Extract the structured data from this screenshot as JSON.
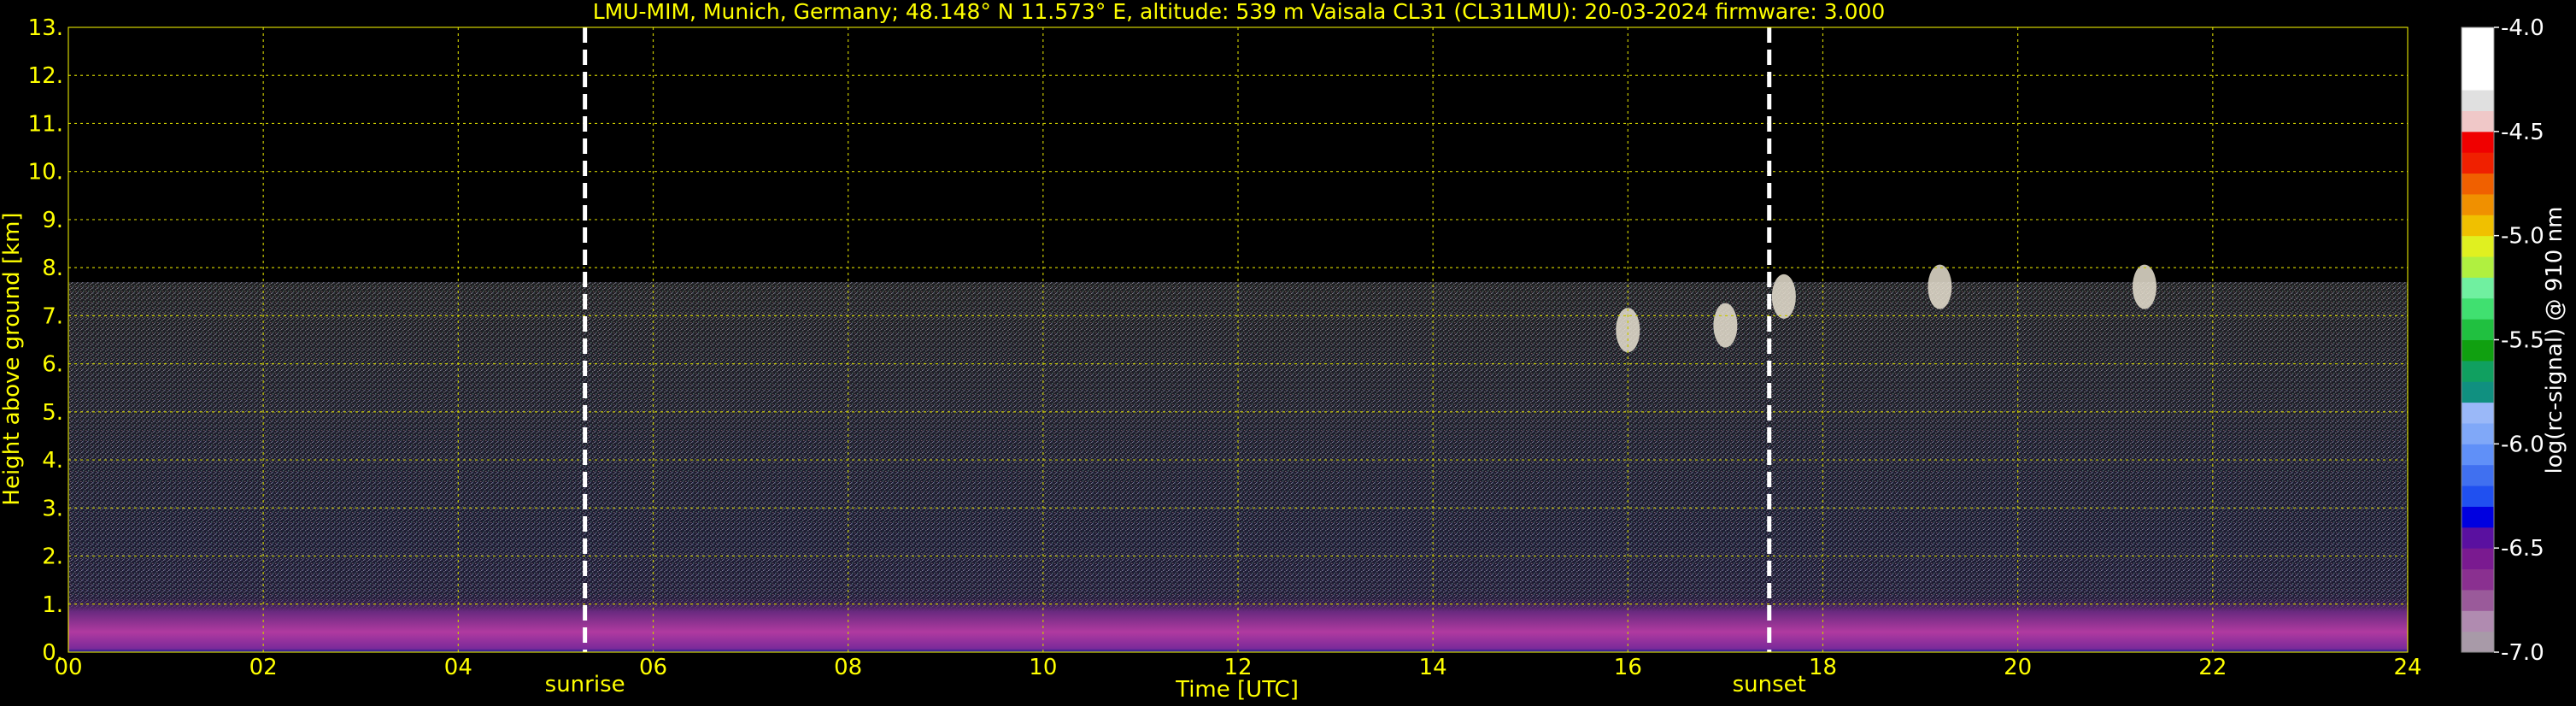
{
  "chart_data": {
    "type": "heatmap",
    "title": "LMU-MIM, Munich, Germany; 48.148° N 11.573° E, altitude: 539 m    Vaisala CL31 (CL31LMU): 20-03-2024    firmware: 3.000",
    "xlabel": "Time [UTC]",
    "ylabel": "Height above ground [km]",
    "xlim": [
      0,
      24
    ],
    "ylim": [
      0,
      13
    ],
    "x_ticks": [
      "00",
      "02",
      "04",
      "06",
      "08",
      "10",
      "12",
      "14",
      "16",
      "18",
      "20",
      "22",
      "24"
    ],
    "y_ticks": [
      "0.",
      "1.",
      "2.",
      "3.",
      "4.",
      "5.",
      "6.",
      "7.",
      "8.",
      "9.",
      "10.",
      "11.",
      "12.",
      "13."
    ],
    "grid": true,
    "events": [
      {
        "label": "sunrise",
        "x": 5.3
      },
      {
        "label": "sunset",
        "x": 17.45
      }
    ],
    "signal_top_km": 7.7,
    "colorbar": {
      "label": "log(rc-signal) @ 910 nm",
      "range": [
        -7.0,
        -4.0
      ],
      "ticks": [
        "-4.0",
        "-4.5",
        "-5.0",
        "-5.5",
        "-6.0",
        "-6.5",
        "-7.0"
      ],
      "colors": [
        "#a89aa8",
        "#b08bb0",
        "#9a5a9a",
        "#8a3090",
        "#7a1a90",
        "#5a10a0",
        "#0000e0",
        "#2050f0",
        "#4070f0",
        "#6090f8",
        "#80a8f8",
        "#9ab8f8",
        "#109080",
        "#10a060",
        "#10a010",
        "#20c040",
        "#40e070",
        "#70f0a0",
        "#b0f040",
        "#e0f020",
        "#f0c000",
        "#f09000",
        "#f06000",
        "#f02000",
        "#f00000",
        "#f0c8c8",
        "#e0e0e0",
        "#ffffff",
        "#ffffff",
        "#ffffff"
      ]
    },
    "clouds": [
      {
        "x": 16.0,
        "y": 6.7
      },
      {
        "x": 17.0,
        "y": 6.8
      },
      {
        "x": 17.6,
        "y": 7.4
      },
      {
        "x": 19.2,
        "y": 7.6
      },
      {
        "x": 21.3,
        "y": 7.6
      }
    ]
  }
}
